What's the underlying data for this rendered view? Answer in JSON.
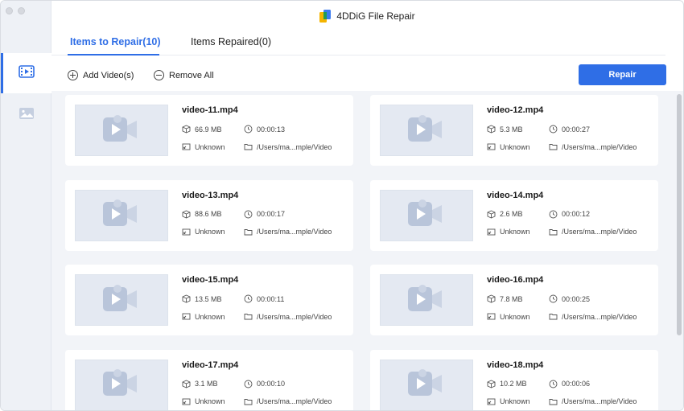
{
  "window": {
    "title": "4DDiG File Repair"
  },
  "sidebar": {
    "items": [
      {
        "name": "video-repair",
        "icon": "video-icon",
        "active": true
      },
      {
        "name": "photo-repair",
        "icon": "image-icon",
        "active": false
      }
    ]
  },
  "tabs": [
    {
      "label": "Items to Repair(10)",
      "active": true
    },
    {
      "label": "Items Repaired(0)",
      "active": false
    }
  ],
  "toolbar": {
    "add_label": "Add Video(s)",
    "remove_label": "Remove All",
    "repair_label": "Repair"
  },
  "colors": {
    "accent": "#2f6ee6",
    "thumb_icon": "#9cabc6"
  },
  "files": [
    {
      "name": "video-11.mp4",
      "size": "66.9 MB",
      "duration": "00:00:13",
      "resolution": "Unknown",
      "path": "/Users/ma...mple/Video"
    },
    {
      "name": "video-12.mp4",
      "size": "5.3 MB",
      "duration": "00:00:27",
      "resolution": "Unknown",
      "path": "/Users/ma...mple/Video"
    },
    {
      "name": "video-13.mp4",
      "size": "88.6 MB",
      "duration": "00:00:17",
      "resolution": "Unknown",
      "path": "/Users/ma...mple/Video"
    },
    {
      "name": "video-14.mp4",
      "size": "2.6 MB",
      "duration": "00:00:12",
      "resolution": "Unknown",
      "path": "/Users/ma...mple/Video"
    },
    {
      "name": "video-15.mp4",
      "size": "13.5 MB",
      "duration": "00:00:11",
      "resolution": "Unknown",
      "path": "/Users/ma...mple/Video"
    },
    {
      "name": "video-16.mp4",
      "size": "7.8 MB",
      "duration": "00:00:25",
      "resolution": "Unknown",
      "path": "/Users/ma...mple/Video"
    },
    {
      "name": "video-17.mp4",
      "size": "3.1 MB",
      "duration": "00:00:10",
      "resolution": "Unknown",
      "path": "/Users/ma...mple/Video"
    },
    {
      "name": "video-18.mp4",
      "size": "10.2 MB",
      "duration": "00:00:06",
      "resolution": "Unknown",
      "path": "/Users/ma...mple/Video"
    }
  ]
}
